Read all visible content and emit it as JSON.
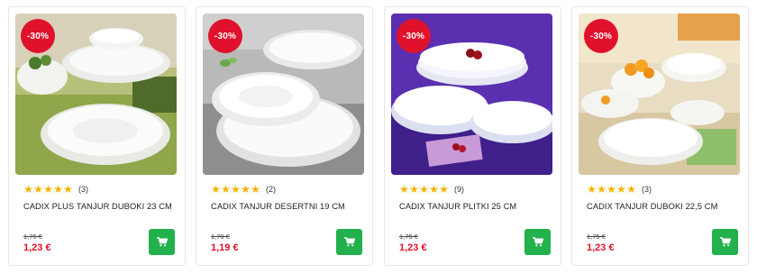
{
  "products": [
    {
      "badge": "-30%",
      "stars": 5,
      "reviews": "(3)",
      "title": "CADIX PLUS TANJUR DUBOKI 23 CM",
      "old_price": "1,75 €",
      "price": "1,23 €",
      "image": "deep plates on green placemat",
      "colors": {
        "bg": "#8a9a4a"
      }
    },
    {
      "badge": "-30%",
      "stars": 5,
      "reviews": "(2)",
      "title": "CADIX TANJUR DESERTNI 19 CM",
      "old_price": "1,70 €",
      "price": "1,19 €",
      "image": "dessert plates on grey table",
      "colors": {
        "bg": "#9a9a9a"
      }
    },
    {
      "badge": "-30%",
      "stars": 5,
      "reviews": "(9)",
      "title": "CADIX TANJUR PLITKI 25 CM",
      "old_price": "1,75 €",
      "price": "1,23 €",
      "image": "flat plates on purple background",
      "colors": {
        "bg": "#5a2fb0"
      }
    },
    {
      "badge": "-30%",
      "stars": 5,
      "reviews": "(3)",
      "title": "CADIX TANJUR DUBOKI 22,5 CM",
      "old_price": "1,75 €",
      "price": "1,23 €",
      "image": "deep plates with oranges on table",
      "colors": {
        "bg": "#d9c9a8"
      }
    }
  ],
  "ui": {
    "accent_red": "#e0122b",
    "cart_green": "#22b14c",
    "star_color": "#f5b301",
    "cart_icon": "shopping-cart-icon",
    "star_icon": "star-icon"
  }
}
